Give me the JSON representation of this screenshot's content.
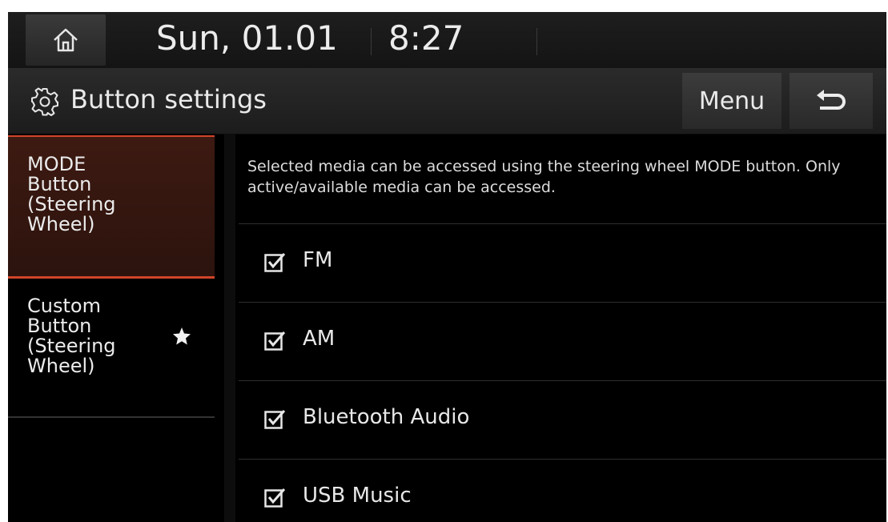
{
  "status_bar": {
    "date": "Sun, 01.01",
    "time": "8:27",
    "home_icon": "home-icon"
  },
  "title_bar": {
    "title": "Button settings",
    "title_icon": "gear-icon",
    "menu_label": "Menu",
    "back_icon": "back-arrow-icon"
  },
  "sidebar": {
    "items": [
      {
        "label": "MODE\nButton\n(Steering\nWheel)",
        "selected": true
      },
      {
        "label": "Custom\nButton\n(Steering\nWheel)",
        "selected": false,
        "icon": "star-icon"
      }
    ]
  },
  "content": {
    "description": "Selected media can be accessed using the steering wheel MODE button. Only active/available media can be accessed.",
    "items": [
      {
        "label": "FM",
        "checked": true
      },
      {
        "label": "AM",
        "checked": true
      },
      {
        "label": "Bluetooth Audio",
        "checked": true
      },
      {
        "label": "USB Music",
        "checked": true
      }
    ]
  },
  "colors": {
    "accent": "#d0452a",
    "selected_bg": "#3d1a12",
    "background": "#000000"
  }
}
